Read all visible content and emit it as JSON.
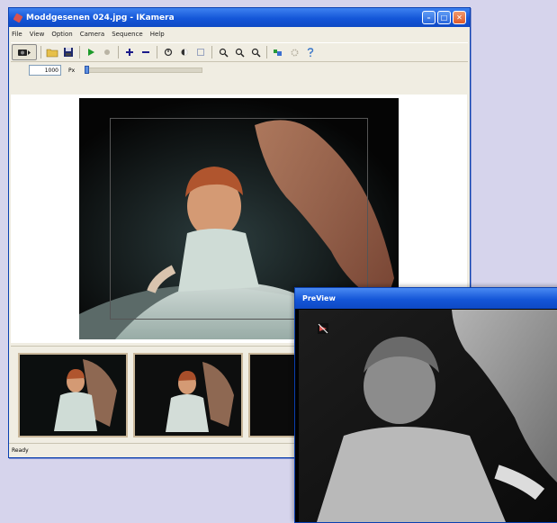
{
  "main_window": {
    "title": "Moddgesenen 024.jpg - IKamera",
    "menu": [
      "File",
      "View",
      "Option",
      "Camera",
      "Sequence",
      "Help"
    ],
    "zoom": {
      "value": "1000",
      "label": "Px"
    },
    "status": "Ready"
  },
  "preview_window": {
    "title": "PreView"
  },
  "colors": {
    "titlebar": "#1456d8",
    "desktop": "#d6d4ec",
    "window_bg": "#f0ede2",
    "close_button": "#dd5a2b"
  },
  "icons": {
    "camera": "camera-icon",
    "open": "open-folder-icon",
    "save": "save-icon",
    "play": "play-icon",
    "stop": "stop-icon",
    "zoom_in": "plus-icon",
    "zoom_out": "minus-icon",
    "help": "help-icon"
  }
}
